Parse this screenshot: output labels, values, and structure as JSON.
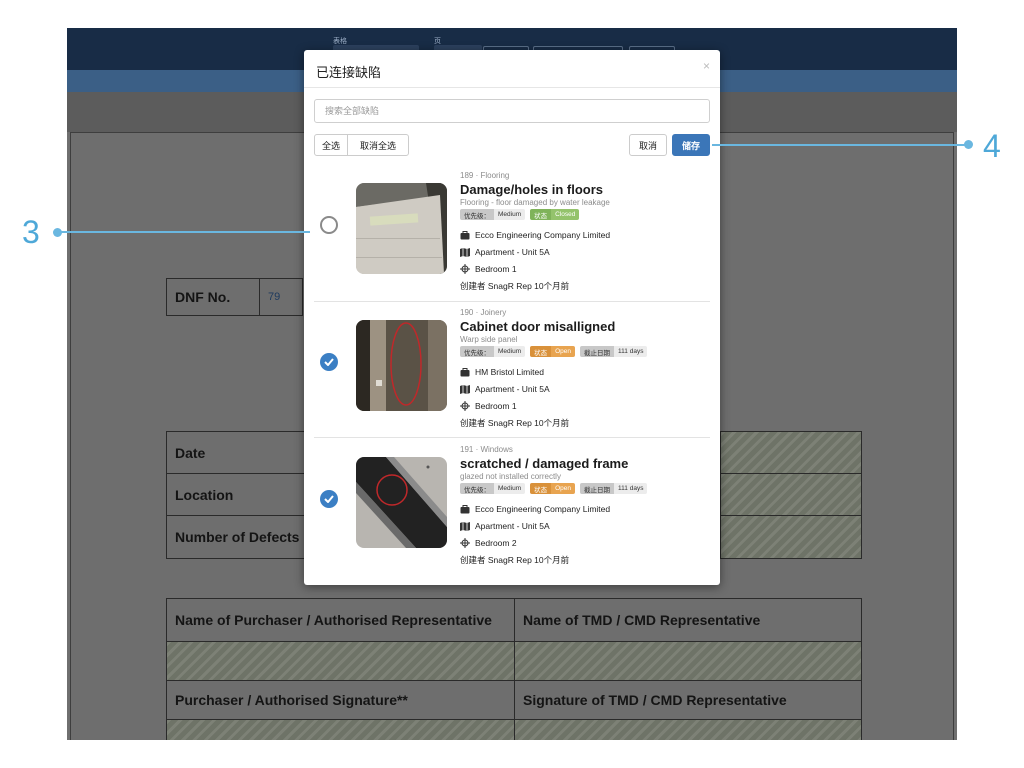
{
  "topbar": {
    "label_left": "表格",
    "label_right": "页"
  },
  "form": {
    "dnf_label": "DNF No.",
    "dnf_value": "79",
    "date_label": "Date",
    "location_label": "Location",
    "defects_label": "Number of Defects",
    "purchaser_name_label": "Name of Purchaser / Authorised Representative",
    "tmd_name_label": "Name of TMD / CMD Representative",
    "purchaser_sig_label": "Purchaser / Authorised Signature**",
    "tmd_sig_label": "Signature of TMD / CMD Representative"
  },
  "modal": {
    "title": "已连接缺陷",
    "close": "×",
    "search_placeholder": "搜索全部缺陷",
    "select_all": "全选",
    "deselect_all": "取消全选",
    "cancel": "取消",
    "save": "储存"
  },
  "defects": [
    {
      "subtitle": "189 · Flooring",
      "title": "Damage/holes in floors",
      "description": "Flooring - floor damaged by water leakage",
      "priority_label": "优先级：",
      "priority_value": "Medium",
      "status_label": "状态",
      "status_value": "Closed",
      "status_color": "#7fb35a",
      "company": "Ecco Engineering Company Limited",
      "location": "Apartment - Unit 5A",
      "room": "Bedroom 1",
      "creator": "创建者 SnagR Rep 10个月前",
      "selected": false
    },
    {
      "subtitle": "190 · Joinery",
      "title": "Cabinet door misalligned",
      "description": "Warp side panel",
      "priority_label": "优先级：",
      "priority_value": "Medium",
      "status_label": "状态",
      "status_value": "Open",
      "status_color": "#d9913a",
      "due_label": "截止日期",
      "due_value": "111 days",
      "company": "HM Bristol Limited",
      "location": "Apartment - Unit 5A",
      "room": "Bedroom 1",
      "creator": "创建者 SnagR Rep 10个月前",
      "selected": true
    },
    {
      "subtitle": "191 · Windows",
      "title": "scratched / damaged frame",
      "description": "glazed not installed correctly",
      "priority_label": "优先级：",
      "priority_value": "Medium",
      "status_label": "状态",
      "status_value": "Open",
      "status_color": "#d9913a",
      "due_label": "截止日期",
      "due_value": "111 days",
      "company": "Ecco Engineering Company Limited",
      "location": "Apartment - Unit 5A",
      "room": "Bedroom 2",
      "creator": "创建者 SnagR Rep 10个月前",
      "selected": true
    }
  ],
  "annotations": {
    "left": "3",
    "right": "4"
  },
  "icons": {
    "company": "briefcase-icon",
    "location": "map-icon",
    "room": "crosshair-icon",
    "selected": "check-circle-icon",
    "unselected": "radio-empty-icon"
  },
  "colors": {
    "accent": "#3b76b8",
    "annotation": "#4ea8d8",
    "topbar": "#182c46"
  }
}
